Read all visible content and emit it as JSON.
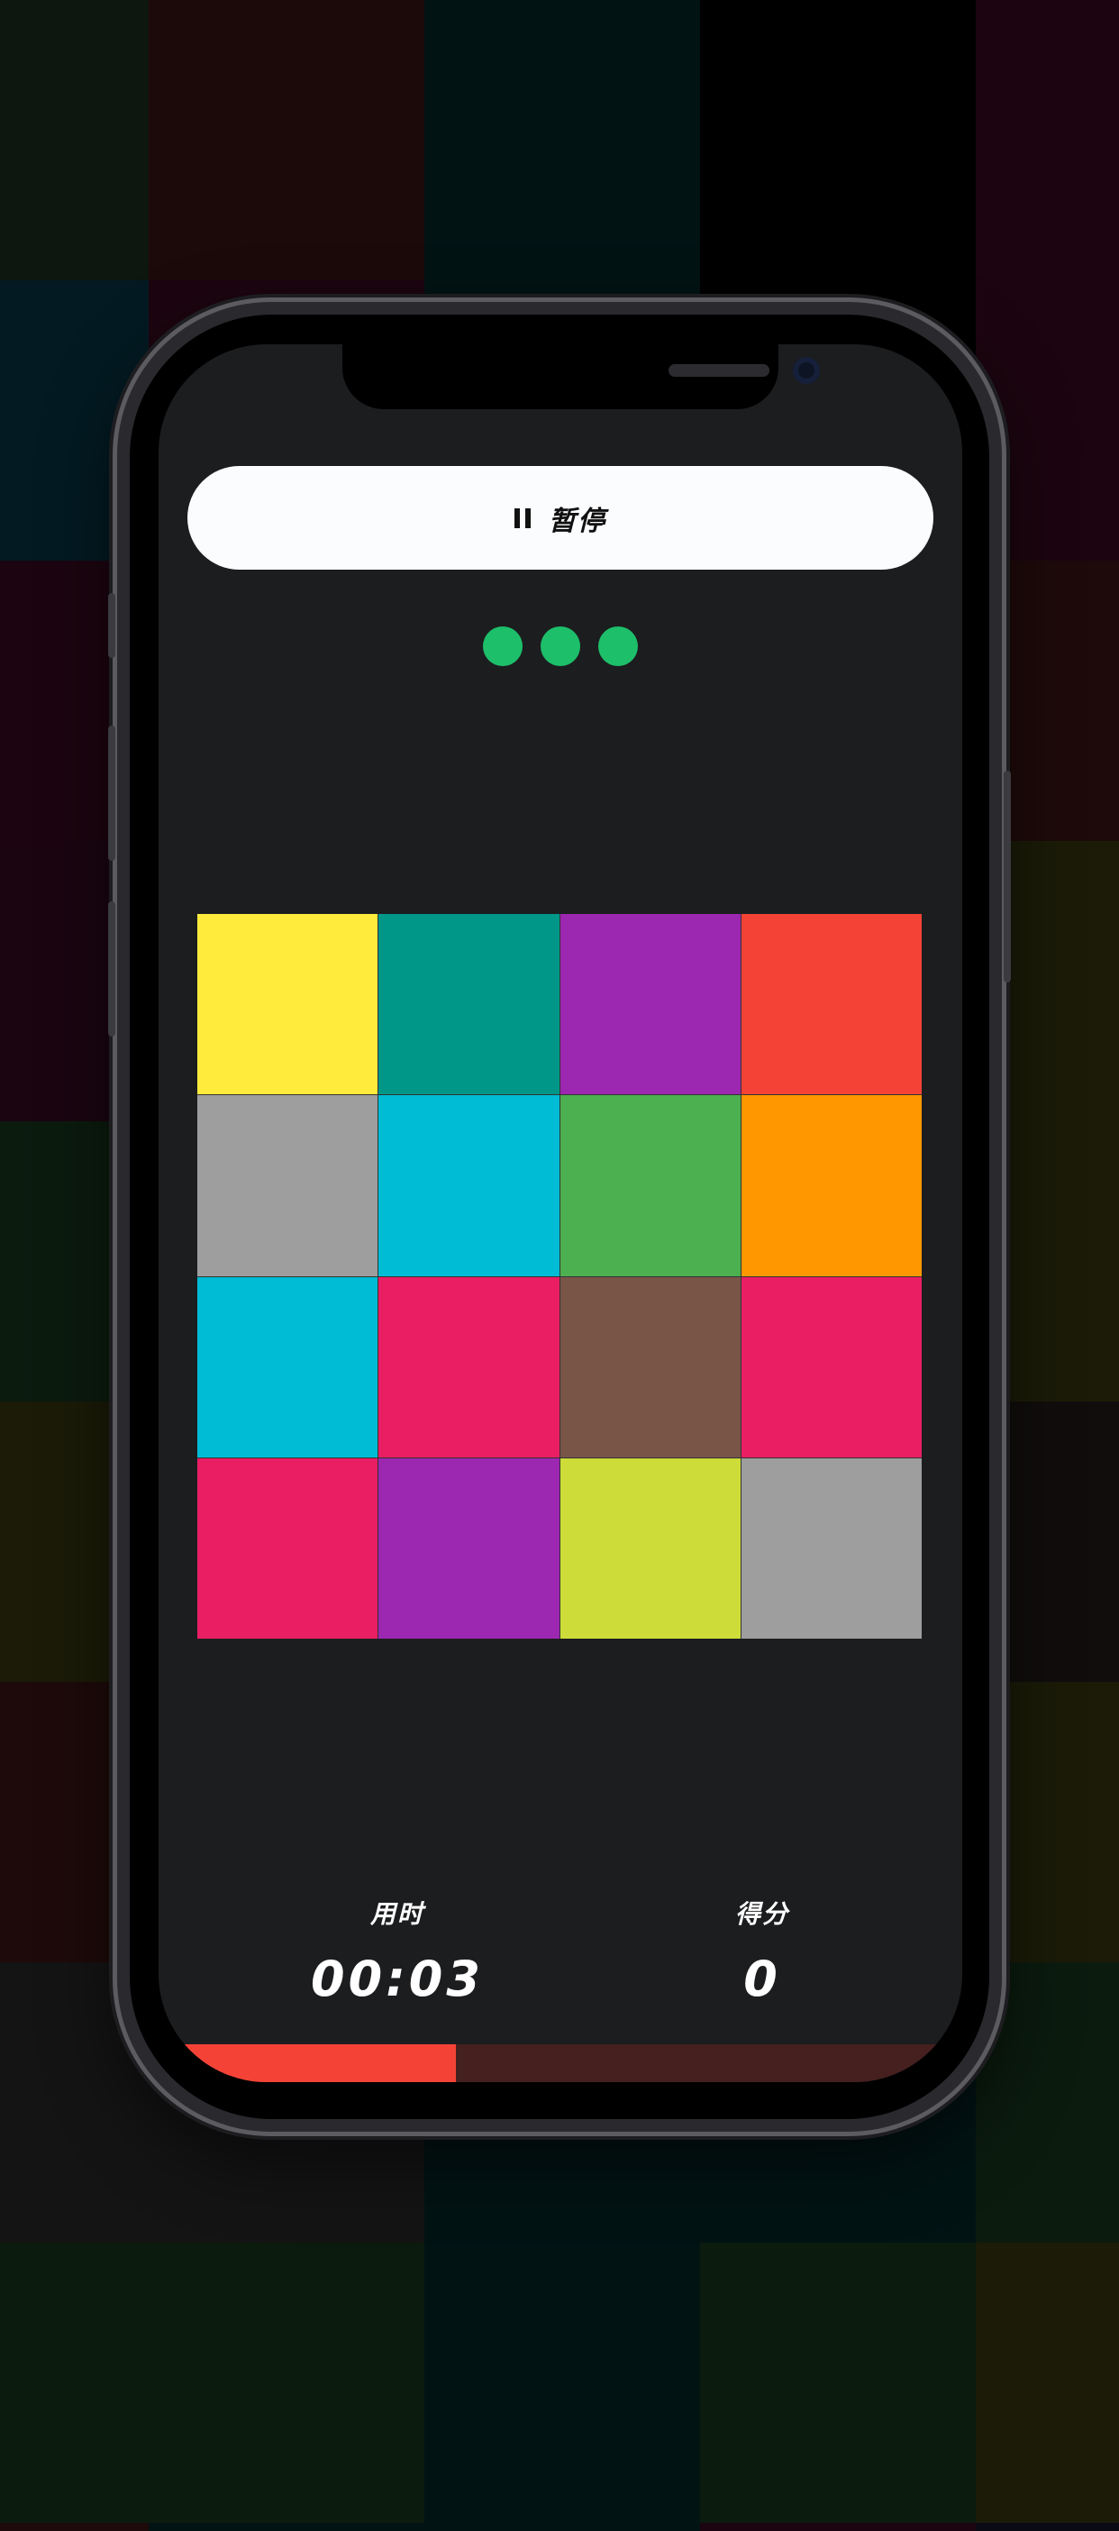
{
  "background": {
    "cells": [
      "#0d170f",
      "#1c0a0a",
      "#021314",
      "#000000",
      "#1c0510",
      "#031a22",
      "#1c0510",
      "#021314",
      "#000000",
      "#1c0510",
      "#1c0510",
      "#1c0510",
      "#1e1c07",
      "#161616",
      "#1e0a0a",
      "#1a0511",
      "#190a14",
      "#1f1c07",
      "#141414",
      "#1b1b08",
      "#0b1b0e",
      "#1b1b08",
      "#1b1b08",
      "#000000",
      "#1b1b08",
      "#1b1b08",
      "#1b1b08",
      "#0d170f",
      "#161616",
      "#110d0d",
      "#1e0a0a",
      "#1e0a0a",
      "#1b1b08",
      "#1b1b08",
      "#1b1b08",
      "#141414",
      "#141414",
      "#021314",
      "#021314",
      "#0b1b0e",
      "#0b1b0e",
      "#0b1b0e",
      "#021314",
      "#0b1b0e",
      "#1b1b08",
      "#1e0a0a",
      "#021314",
      "#021314",
      "#1c0510",
      "#0a0a14"
    ]
  },
  "header": {
    "pause_label": "暂停"
  },
  "lives": {
    "count": 3,
    "color": "#1dbf6a"
  },
  "board": {
    "tiles": [
      "#ffeb3b",
      "#009688",
      "#9c27b0",
      "#f44336",
      "#9e9e9e",
      "#00bcd4",
      "#4caf50",
      "#ff9800",
      "#00bcd4",
      "#e91e63",
      "#795548",
      "#e91e63",
      "#e91e63",
      "#9c27b0",
      "#cddc39",
      "#9e9e9e"
    ]
  },
  "stats": {
    "time_label": "用时",
    "time_value": "00:03",
    "score_label": "得分",
    "score_value": "0"
  },
  "progress": {
    "fraction": 0.37,
    "fill_color": "#f44336",
    "track_color": "#45201f"
  }
}
